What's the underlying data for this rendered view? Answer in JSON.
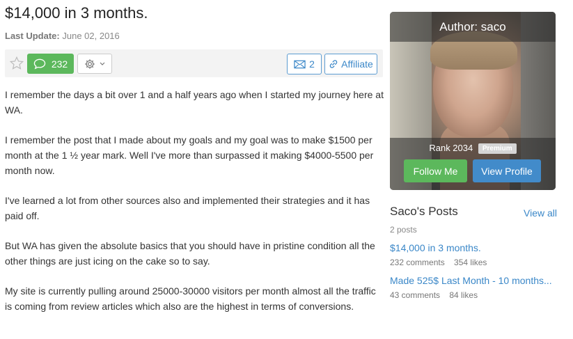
{
  "article": {
    "title": "$14,000 in 3 months.",
    "last_update_label": "Last Update:",
    "last_update_date": "June 02, 2016",
    "comment_count": "232",
    "message_count": "2",
    "affiliate_label": "Affiliate",
    "paragraphs": [
      "I remember the days a bit over 1 and a half years ago when I started my journey here at WA.",
      "I remember the post that I made about my goals and my goal was to make $1500 per month at the 1 ½ year mark. Well I've more than surpassed it making $4000-5500 per month now.",
      "I've learned a lot from other sources also and implemented their strategies and it has paid off.",
      "But WA has given the absolute basics that you should have in pristine condition all the other things are just icing on the cake so to say.",
      "My site is currently pulling around 25000-30000 visitors per month almost all the traffic is coming from review articles which also are the highest in terms of conversions."
    ]
  },
  "author": {
    "header": "Author: saco",
    "rank": "Rank 2034",
    "badge": "Premium",
    "follow_label": "Follow Me",
    "profile_label": "View Profile"
  },
  "posts": {
    "title": "Saco's Posts",
    "view_all": "View all",
    "count": "2 posts",
    "items": [
      {
        "title": "$14,000 in 3 months.",
        "comments": "232 comments",
        "likes": "354 likes"
      },
      {
        "title": "Made 525$ Last Month - 10 months...",
        "comments": "43 comments",
        "likes": "84 likes"
      }
    ]
  },
  "icons": {
    "star": "star-icon",
    "comment": "speech-bubble-icon",
    "gear": "gear-icon",
    "envelope": "envelope-icon",
    "link": "link-icon"
  },
  "colors": {
    "green": "#5cb85c",
    "blue": "#428bca",
    "link": "#3a87c8"
  }
}
